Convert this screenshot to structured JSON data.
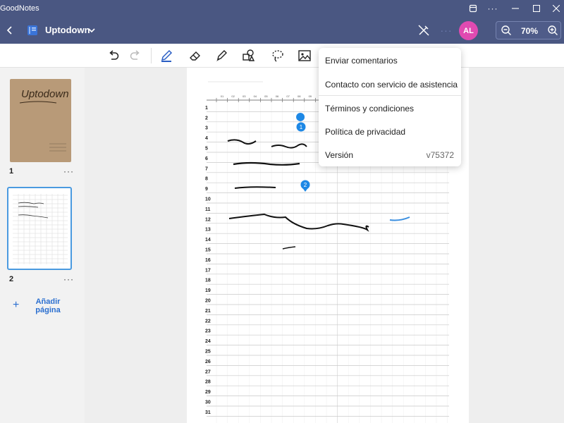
{
  "window": {
    "app_title": "GoodNotes"
  },
  "header": {
    "doc_title": "Uptodown",
    "avatar_initials": "AL",
    "zoom": "70%",
    "colors": {
      "bar": "#4a5782",
      "avatar": "#e04ab1"
    }
  },
  "toolbar": {
    "tools": [
      "undo-icon",
      "redo-icon",
      "pen-icon",
      "eraser-icon",
      "highlighter-icon",
      "shapes-icon",
      "lasso-icon",
      "image-icon"
    ]
  },
  "sidebar": {
    "pages": [
      {
        "number": "1",
        "more": "···",
        "cover_text": "Uptodown"
      },
      {
        "number": "2",
        "more": "···"
      }
    ],
    "add_page_label": "Añadir página"
  },
  "menu": {
    "items": [
      {
        "label": "Enviar comentarios"
      },
      {
        "label": "Contacto con servicio de asistencia"
      },
      {
        "label": "Términos y condiciones"
      },
      {
        "label": "Política de privacidad"
      },
      {
        "label": "Versión",
        "value": "v75372"
      }
    ]
  },
  "notebook": {
    "row_numbers": [
      "1",
      "2",
      "3",
      "4",
      "5",
      "6",
      "7",
      "8",
      "9",
      "10",
      "11",
      "12",
      "13",
      "14",
      "15",
      "16",
      "17",
      "18",
      "19",
      "20",
      "21",
      "22",
      "23",
      "24",
      "25",
      "26",
      "27",
      "28",
      "29",
      "30",
      "31"
    ],
    "markers": [
      "1",
      "2"
    ],
    "column_header_labels": [
      "01",
      "02",
      "03",
      "04",
      "05",
      "06",
      "07",
      "08",
      "09",
      "10"
    ]
  }
}
